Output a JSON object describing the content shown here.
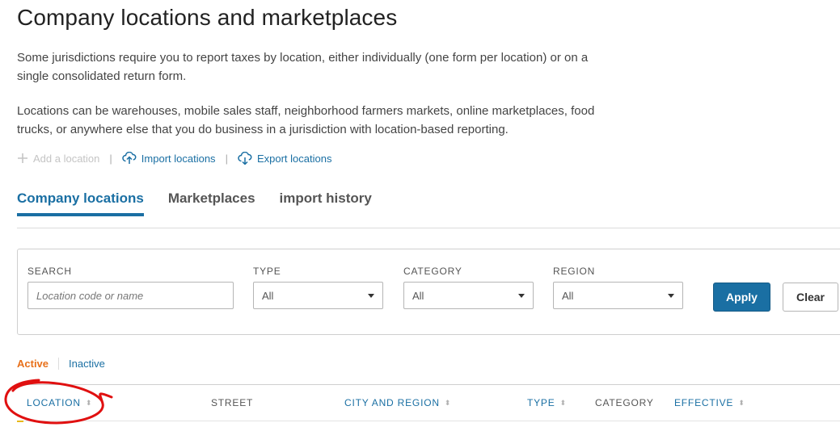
{
  "page": {
    "title": "Company locations and marketplaces",
    "paragraph1": "Some jurisdictions require you to report taxes by location, either individually (one form per location) or on a single consolidated return form.",
    "paragraph2": "Locations can be warehouses, mobile sales staff, neighborhood farmers markets, online marketplaces, food trucks, or anywhere else that you do business in a jurisdiction with location-based reporting."
  },
  "actions": {
    "add_label": "Add a location",
    "import_label": "Import locations",
    "export_label": "Export locations",
    "separator": "|"
  },
  "tabs": [
    {
      "label": "Company locations",
      "active": true
    },
    {
      "label": "Marketplaces",
      "active": false
    },
    {
      "label": "import history",
      "active": false
    }
  ],
  "filters": {
    "search_label": "SEARCH",
    "search_placeholder": "Location code or name",
    "type_label": "TYPE",
    "type_value": "All",
    "category_label": "CATEGORY",
    "category_value": "All",
    "region_label": "REGION",
    "region_value": "All",
    "apply_label": "Apply",
    "clear_label": "Clear"
  },
  "status_tabs": {
    "active_label": "Active",
    "inactive_label": "Inactive"
  },
  "table": {
    "columns": [
      {
        "label": "LOCATION",
        "sortable": true
      },
      {
        "label": "STREET",
        "sortable": false
      },
      {
        "label": "CITY AND REGION",
        "sortable": true
      },
      {
        "label": "TYPE",
        "sortable": true
      },
      {
        "label": "CATEGORY",
        "sortable": false
      },
      {
        "label": "EFFECTIVE",
        "sortable": true
      }
    ]
  },
  "colors": {
    "primary": "#1a6fa3",
    "active_orange": "#e8701a",
    "annotation_red": "#e01010"
  },
  "icons": {
    "add": "plus-icon",
    "import": "cloud-upload-icon",
    "export": "cloud-download-icon",
    "sort": "sort-arrow-icon",
    "dropdown": "caret-down-icon"
  }
}
